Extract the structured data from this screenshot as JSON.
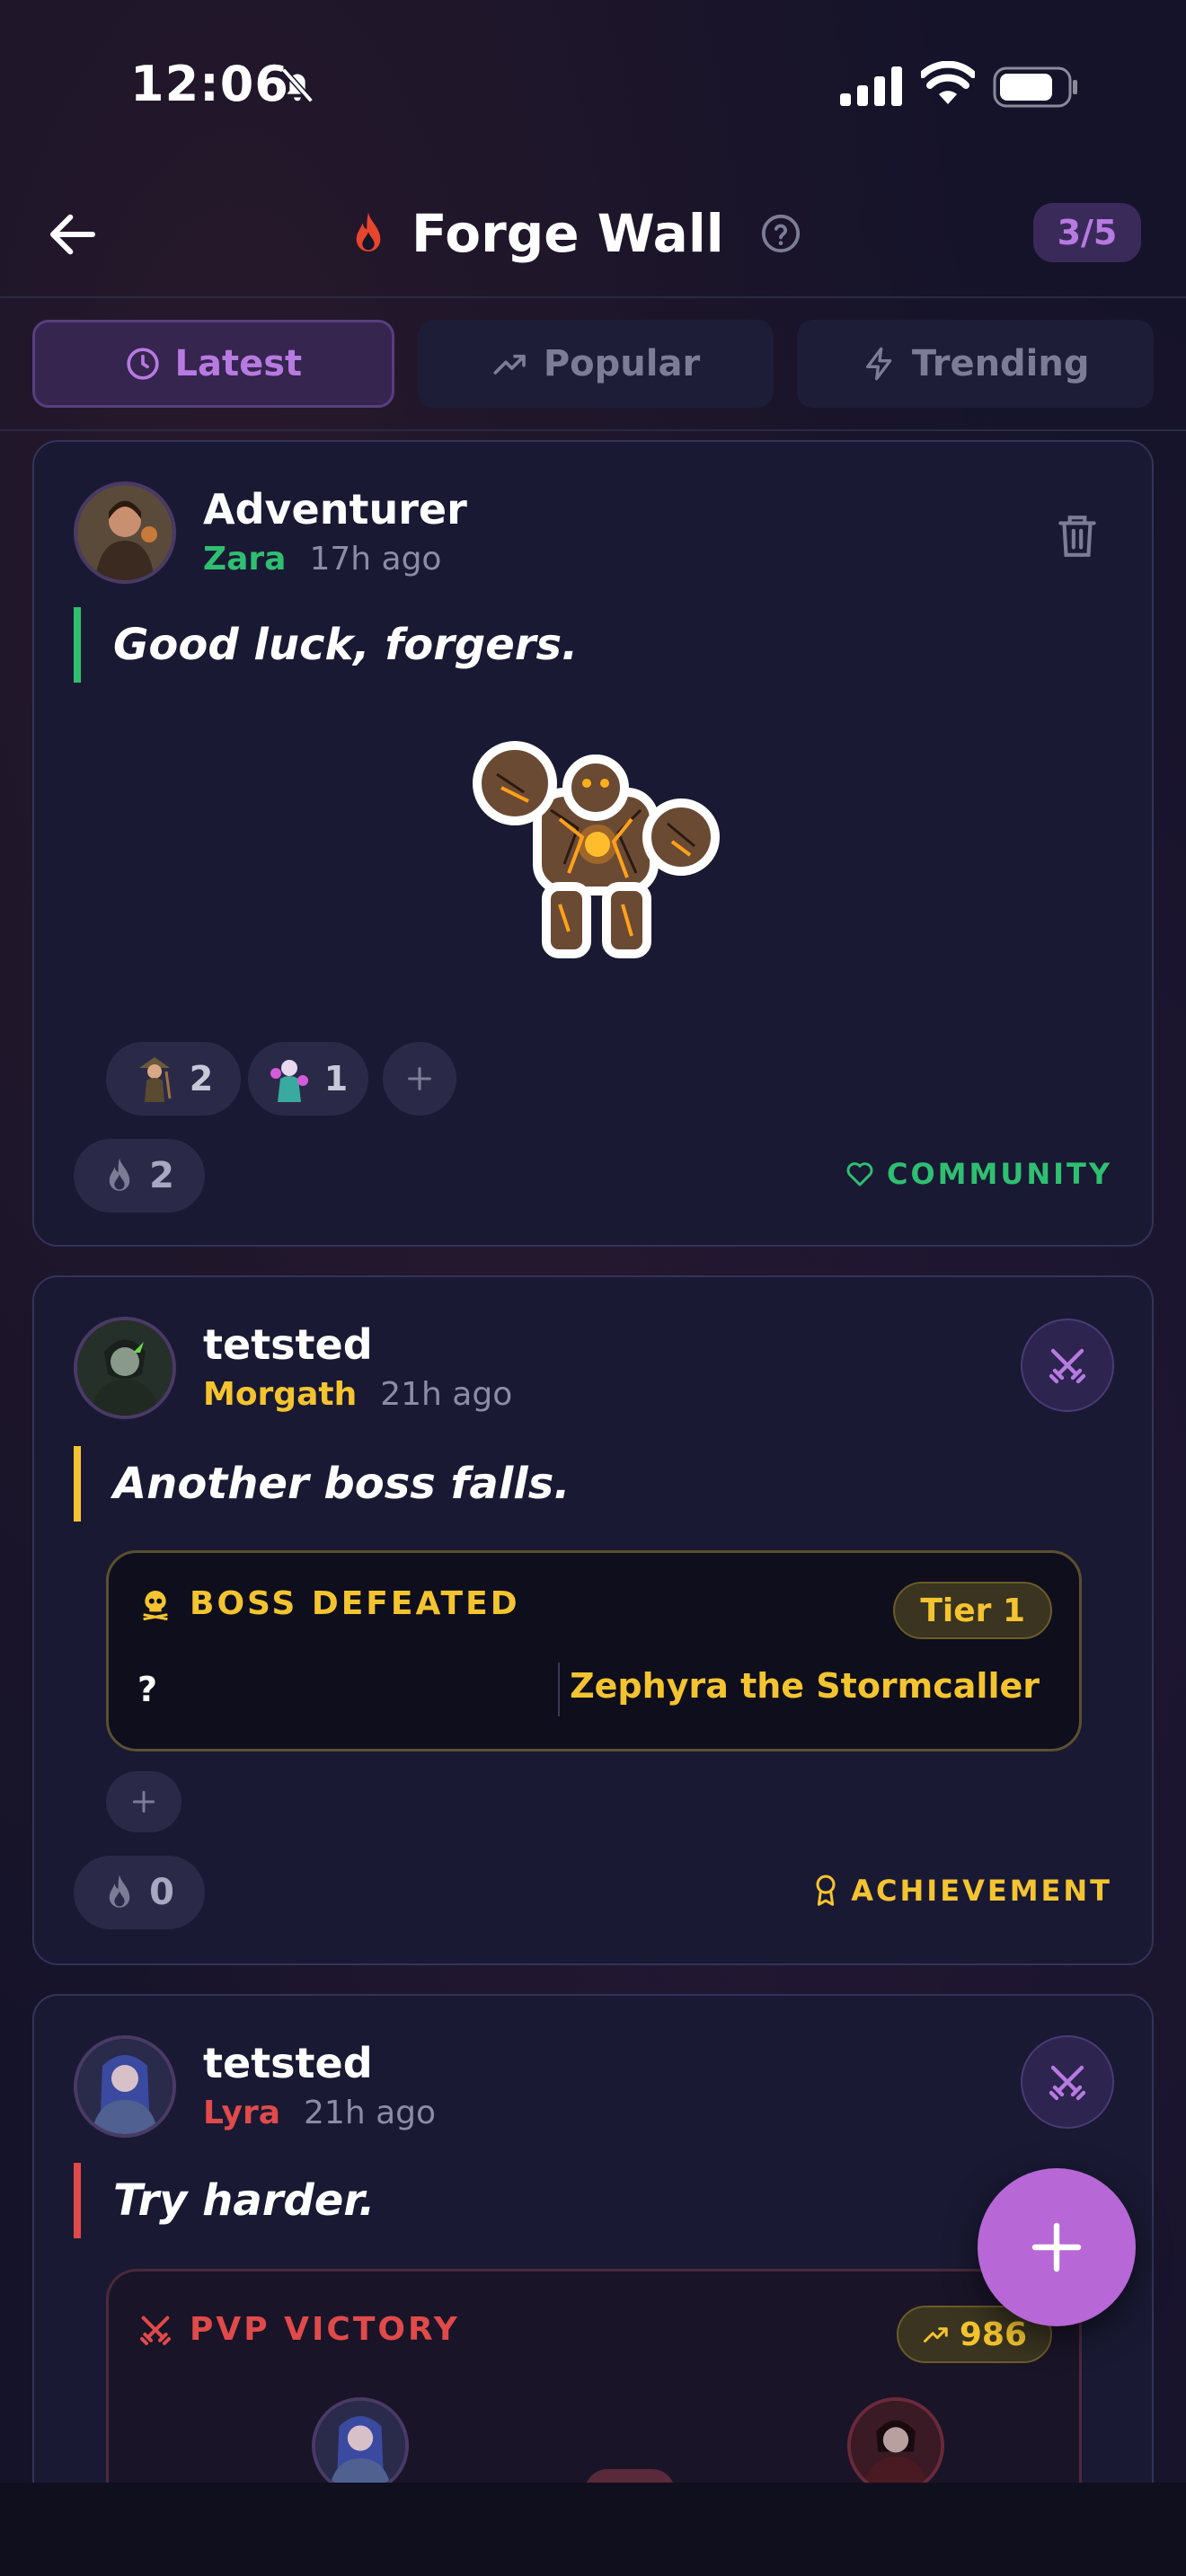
{
  "status_bar": {
    "time": "12:06"
  },
  "header": {
    "title": "Forge Wall",
    "progress": "3/5"
  },
  "tabs": [
    {
      "label": "Latest",
      "icon": "clock-icon",
      "active": true
    },
    {
      "label": "Popular",
      "icon": "trending-up-icon",
      "active": false
    },
    {
      "label": "Trending",
      "icon": "lightning-icon",
      "active": false
    }
  ],
  "posts": [
    {
      "username": "Adventurer",
      "character": "Zara",
      "character_color": "#2fbf71",
      "time": "17h ago",
      "quote": "Good luck, forgers.",
      "quote_color": "#2fbf71",
      "sticker": "golem-sticker",
      "reactions": [
        {
          "icon": "ranger-avatar-icon",
          "count": "2"
        },
        {
          "icon": "mage-avatar-icon",
          "count": "1"
        }
      ],
      "fire_count": "2",
      "category": "COMMUNITY",
      "category_color": "#2fbf71"
    },
    {
      "username": "tetsted",
      "character": "Morgath",
      "character_color": "#f4c430",
      "time": "21h ago",
      "quote": "Another boss falls.",
      "quote_color": "#f4c430",
      "boss": {
        "title": "BOSS DEFEATED",
        "tier": "Tier 1",
        "unknown": "?",
        "name": "Zephyra the Stormcaller"
      },
      "fire_count": "0",
      "category": "ACHIEVEMENT",
      "category_color": "#f4c430"
    },
    {
      "username": "tetsted",
      "character": "Lyra",
      "character_color": "#e04a4a",
      "time": "21h ago",
      "quote": "Try harder.",
      "quote_color": "#e04a4a",
      "pvp": {
        "title": "PVP VICTORY",
        "rating": "986"
      }
    }
  ],
  "colors": {
    "accent": "#b767d6",
    "background": "#14142a",
    "card": "#1a1a34"
  }
}
